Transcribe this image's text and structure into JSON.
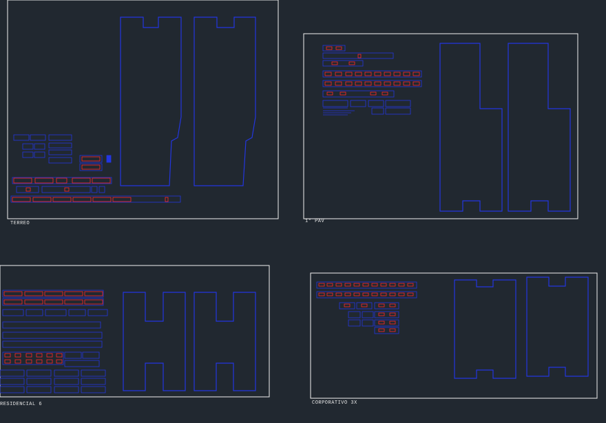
{
  "colors": {
    "background": "#212830",
    "frame": "#f2f2f2",
    "outline": "#2336e0",
    "detail": "#ff2a2a",
    "text": "#e8e8e8"
  },
  "views": [
    {
      "id": "terreo",
      "label": "TERREO"
    },
    {
      "id": "1-pav",
      "label": "1° PAV"
    },
    {
      "id": "residencial",
      "label": "RESIDENCIAL 6"
    },
    {
      "id": "corporativo",
      "label": "CORPORATIVO 3X"
    }
  ]
}
